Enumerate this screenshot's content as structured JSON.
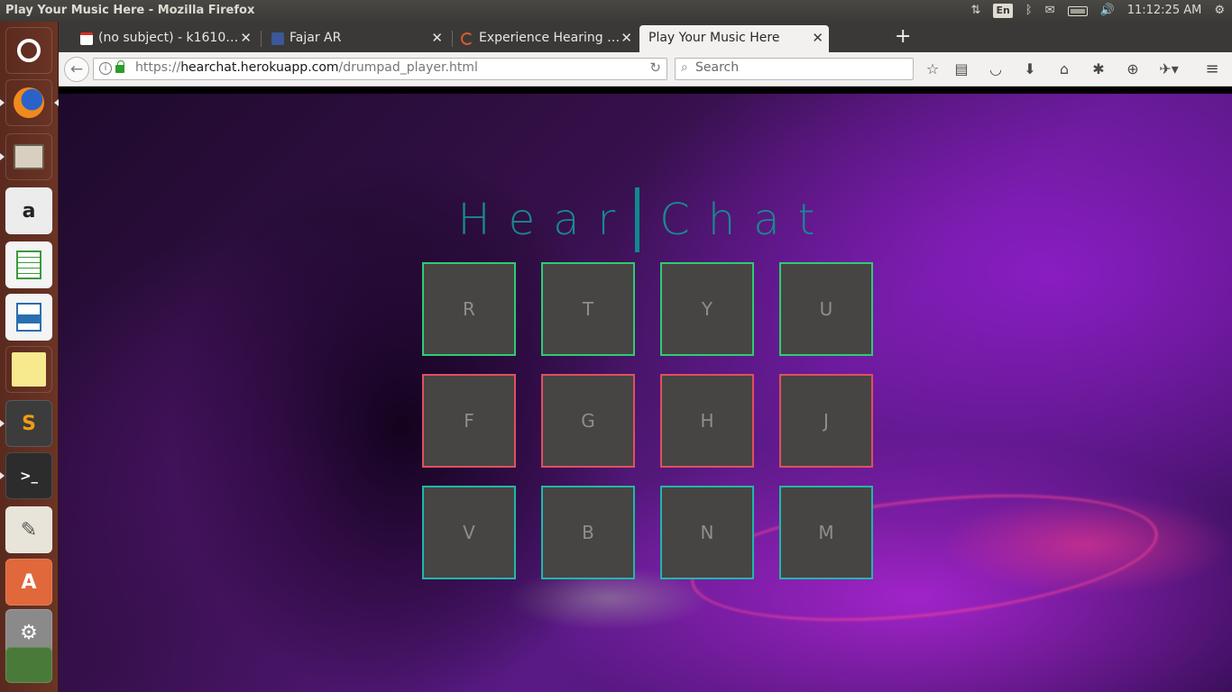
{
  "window": {
    "title": "Play Your Music Here - Mozilla Firefox"
  },
  "panel": {
    "keyboard_layout": "En",
    "time": "11:12:25 AM"
  },
  "launcher": {
    "items": [
      {
        "name": "ubuntu-dash-icon",
        "color": "#e95420"
      },
      {
        "name": "firefox-icon",
        "color": "#e66000"
      },
      {
        "name": "files-icon",
        "color": "#8a7e6c"
      },
      {
        "name": "amazon-icon",
        "color": "#f0f0f0"
      },
      {
        "name": "libreoffice-calc-icon",
        "color": "#3a9a3a"
      },
      {
        "name": "libreoffice-impress-icon",
        "color": "#2a6fb0"
      },
      {
        "name": "sticky-notes-icon",
        "color": "#f5e98a"
      },
      {
        "name": "sublime-text-icon",
        "color": "#5a5a5a"
      },
      {
        "name": "terminal-icon",
        "color": "#2c2c2c"
      },
      {
        "name": "text-editor-icon",
        "color": "#d9d4c7"
      },
      {
        "name": "software-center-icon",
        "color": "#e0683a"
      },
      {
        "name": "system-settings-icon",
        "color": "#8a8a8a"
      },
      {
        "name": "workspace-switcher-icon",
        "color": "#4a8a3a"
      }
    ]
  },
  "browser": {
    "tabs": [
      {
        "label": "(no subject) - k1610…",
        "icon": "gmail-icon",
        "active": false
      },
      {
        "label": "Fajar AR",
        "icon": "facebook-icon",
        "active": false
      },
      {
        "label": "Experience Hearing …",
        "icon": "loading-icon",
        "active": false
      },
      {
        "label": "Play Your Music Here",
        "icon": "",
        "active": true
      }
    ],
    "url": {
      "scheme": "https://",
      "host": "hearchat.herokuapp.com",
      "path": "/drumpad_player.html"
    },
    "search_placeholder": "Search"
  },
  "page": {
    "brand_left": "Hear",
    "brand_right": "Chat",
    "pads": [
      {
        "key": "R",
        "color": "#2ecc71"
      },
      {
        "key": "T",
        "color": "#2ecc71"
      },
      {
        "key": "Y",
        "color": "#2ecc71"
      },
      {
        "key": "U",
        "color": "#2ecc71"
      },
      {
        "key": "F",
        "color": "#e0505e"
      },
      {
        "key": "G",
        "color": "#e0505e"
      },
      {
        "key": "H",
        "color": "#e0505e"
      },
      {
        "key": "J",
        "color": "#e0505e"
      },
      {
        "key": "V",
        "color": "#1fb8a8"
      },
      {
        "key": "B",
        "color": "#1fb8a8"
      },
      {
        "key": "N",
        "color": "#1fb8a8"
      },
      {
        "key": "M",
        "color": "#1fb8a8"
      }
    ]
  }
}
